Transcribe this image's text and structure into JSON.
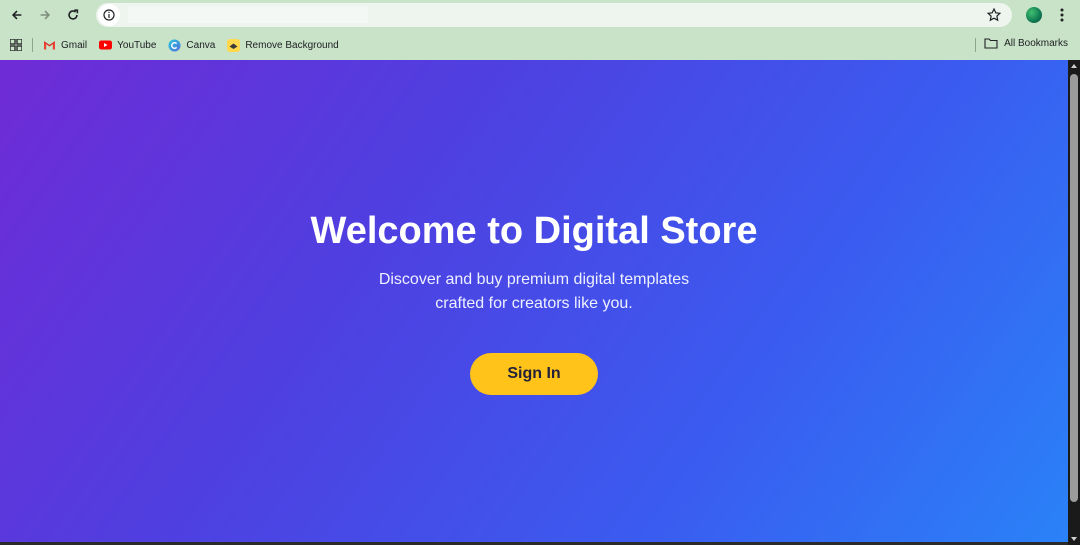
{
  "browser": {
    "address": "",
    "bookmarks": [
      {
        "label": "Gmail",
        "icon": "gmail-icon"
      },
      {
        "label": "YouTube",
        "icon": "youtube-icon"
      },
      {
        "label": "Canva",
        "icon": "canva-icon"
      },
      {
        "label": "Remove Background",
        "icon": "remove-bg-icon"
      }
    ],
    "all_bookmarks_label": "All Bookmarks"
  },
  "hero": {
    "title": "Welcome to Digital Store",
    "subtitle_line1": "Discover and buy premium digital templates",
    "subtitle_line2": "crafted for creators like you.",
    "signin_label": "Sign In"
  },
  "colors": {
    "chrome_bg": "#c8e3c8",
    "gradient_start": "#6f2bd6",
    "gradient_end": "#2a82f8",
    "button_yellow": "#ffc31a",
    "title_text": "#ffffff"
  }
}
